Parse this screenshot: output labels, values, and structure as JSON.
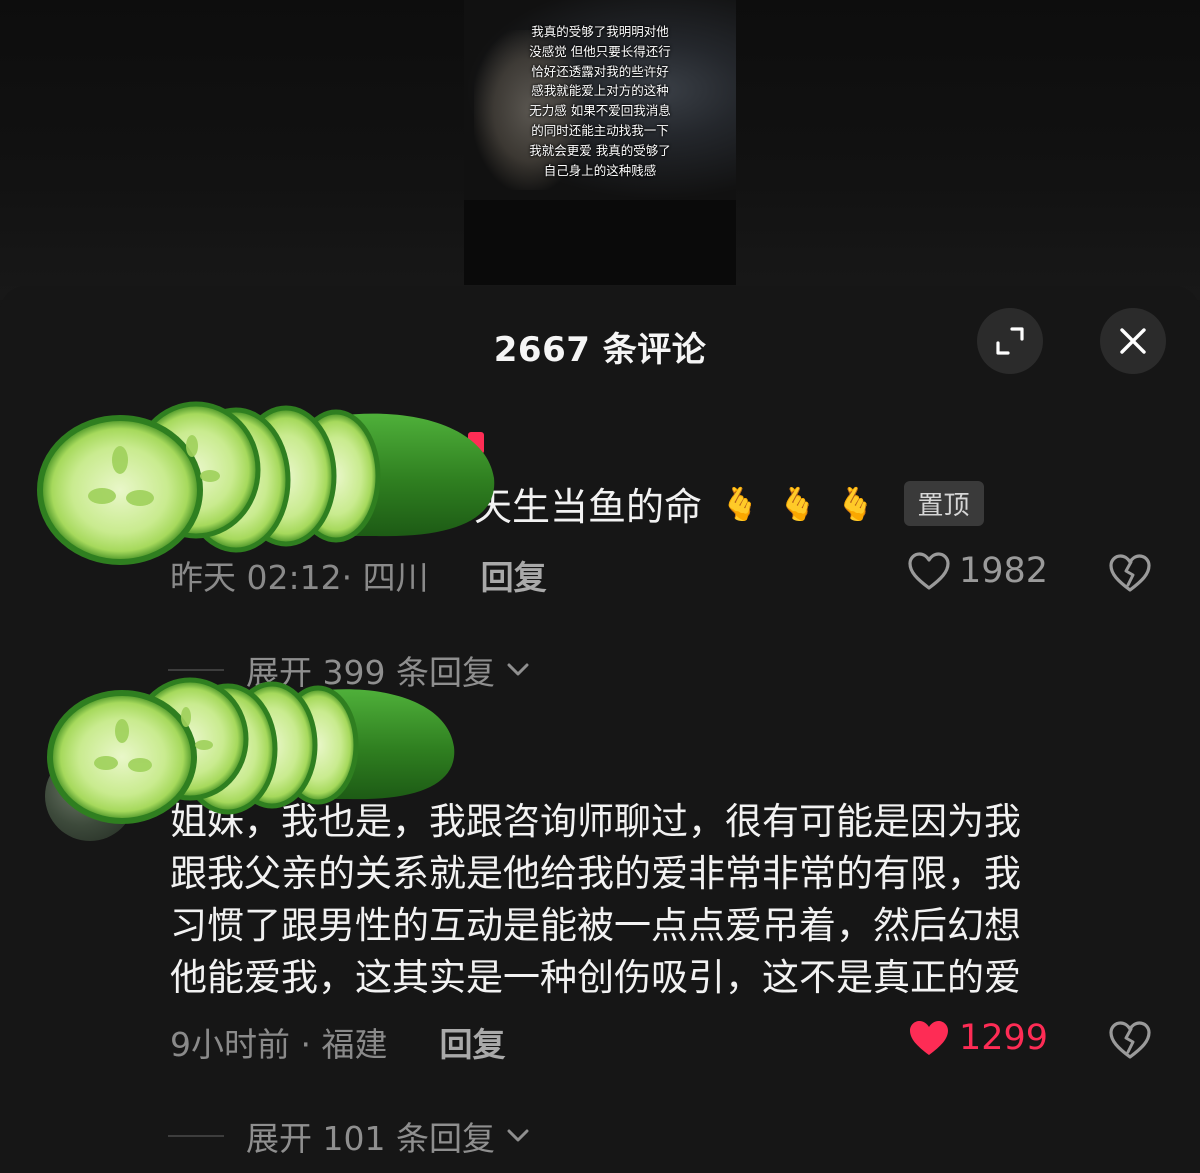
{
  "video": {
    "caption_lines": [
      "我真的受够了我明明对他",
      "没感觉 但他只要长得还行",
      "恰好还透露对我的些许好",
      "感我就能爱上对方的这种",
      "无力感 如果不爱回我消息",
      "的同时还能主动找我一下",
      "我就会更爱 我真的受够了",
      "自己身上的这种贱感"
    ]
  },
  "sheet": {
    "title": "2667 条评论",
    "expand_icon": "expand-icon",
    "close_icon": "close-icon"
  },
  "comments": [
    {
      "text": "天生当鱼的命",
      "emojis": [
        "🫰",
        "🫰",
        "🫰"
      ],
      "pinned_label": "置顶",
      "time_location": "昨天 02:12· 四川",
      "reply_label": "回复",
      "likes": "1982",
      "liked": false,
      "expand_label": "展开 399 条回复"
    },
    {
      "text_lines": [
        "姐妹，我也是，我跟咨询师聊过，很有可能是因为我",
        "跟我父亲的关系就是他给我的爱非常非常的有限，我",
        "习惯了跟男性的互动是能被一点点爱吊着，然后幻想",
        "他能爱我，这其实是一种创伤吸引，这不是真正的爱"
      ],
      "time_location": "9小时前 · 福建",
      "reply_label": "回复",
      "likes": "1299",
      "liked": true,
      "expand_label": "展开 101 条回复"
    }
  ],
  "colors": {
    "background": "#161616",
    "accent_like": "#fe2c55",
    "cucumber": "#3f9a2a"
  }
}
